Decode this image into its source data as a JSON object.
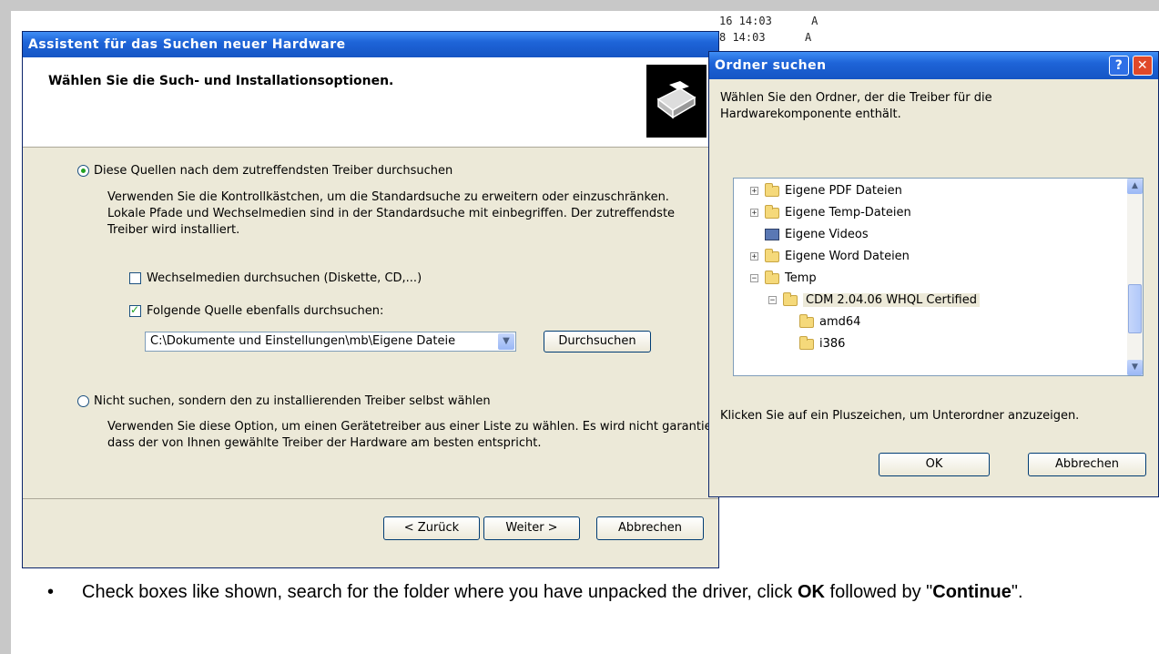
{
  "background_listing": [
    {
      "date": "16 14:03",
      "attr": "A"
    },
    {
      "date": "8 14:03",
      "attr": "A"
    }
  ],
  "wizard": {
    "title": "Assistent für das Suchen neuer Hardware",
    "header_title": "Wählen Sie die Such- und Installationsoptionen.",
    "option1_label": "Diese Quellen nach dem zutreffendsten Treiber durchsuchen",
    "option1_description": "Verwenden Sie die Kontrollkästchen, um die Standardsuche zu erweitern oder einzuschränken. Lokale Pfade und Wechselmedien sind in der Standardsuche mit einbegriffen. Der zutreffendste Treiber wird installiert.",
    "checkbox1_label": "Wechselmedien durchsuchen (Diskette, CD,...)",
    "checkbox1_checked": false,
    "checkbox2_label": "Folgende Quelle ebenfalls durchsuchen:",
    "checkbox2_checked": true,
    "path_value": "C:\\Dokumente und Einstellungen\\mb\\Eigene Dateie",
    "browse_button": "Durchsuchen",
    "option2_label": "Nicht suchen, sondern den zu installierenden Treiber selbst wählen",
    "option2_description": "Verwenden Sie diese Option, um einen Gerätetreiber aus einer Liste zu wählen. Es wird nicht garantiert, dass der von Ihnen gewählte Treiber der Hardware am besten entspricht.",
    "back_button": "< Zurück",
    "next_button": "Weiter >",
    "cancel_button": "Abbrechen"
  },
  "folder_dialog": {
    "title": "Ordner suchen",
    "help_glyph": "?",
    "close_glyph": "✕",
    "prompt": "Wählen Sie den Ordner, der die Treiber für die Hardwarekomponente enthält.",
    "tree": [
      {
        "label": "Eigene PDF Dateien",
        "expander": "+",
        "icon": "folder-icon"
      },
      {
        "label": "Eigene Temp-Dateien",
        "expander": "+",
        "icon": "folder-icon"
      },
      {
        "label": "Eigene Videos",
        "expander": "",
        "icon": "video-folder-icon"
      },
      {
        "label": "Eigene Word Dateien",
        "expander": "+",
        "icon": "folder-icon"
      },
      {
        "label": "Temp",
        "expander": "−",
        "icon": "folder-icon"
      },
      {
        "label": "CDM 2.04.06 WHQL Certified",
        "expander": "−",
        "icon": "folder-icon",
        "selected": true
      },
      {
        "label": "amd64",
        "expander": "",
        "icon": "folder-icon"
      },
      {
        "label": "i386",
        "expander": "",
        "icon": "folder-icon"
      }
    ],
    "hint": "Klicken Sie auf ein Pluszeichen, um Unterordner anzuzeigen.",
    "ok_button": "OK",
    "cancel_button": "Abbrechen"
  },
  "instruction": {
    "bullet": "•",
    "part1": "Check boxes like shown, search for the folder where you have unpacked the driver, click ",
    "ok": "OK",
    "part2": " followed by \"",
    "continue": "Continue",
    "part3": "\"."
  }
}
